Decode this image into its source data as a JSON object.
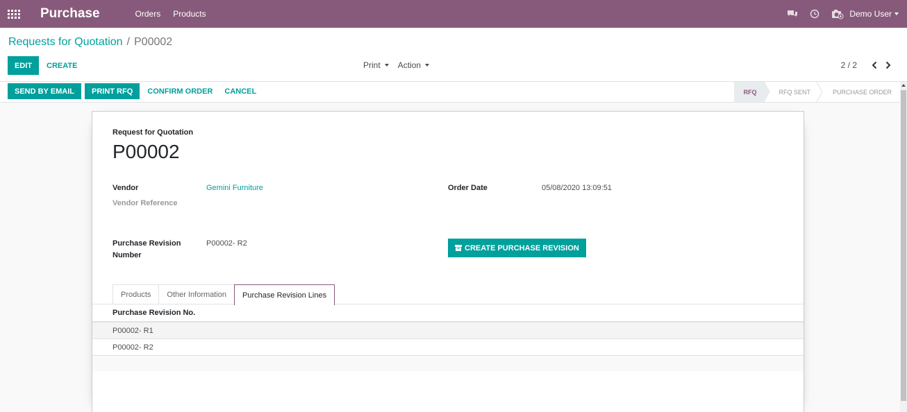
{
  "navbar": {
    "app_name": "Purchase",
    "menu": [
      "Orders",
      "Products"
    ],
    "user": "Demo User"
  },
  "breadcrumb": {
    "parent": "Requests for Quotation",
    "separator": "/",
    "current": "P00002"
  },
  "control": {
    "edit_label": "EDIT",
    "create_label": "CREATE",
    "print_label": "Print",
    "action_label": "Action",
    "pager": "2 / 2"
  },
  "status": {
    "actions": [
      "SEND BY EMAIL",
      "PRINT RFQ",
      "CONFIRM ORDER",
      "CANCEL"
    ],
    "stages": [
      "RFQ",
      "RFQ SENT",
      "PURCHASE ORDER"
    ],
    "active_stage": "RFQ"
  },
  "form": {
    "doc_type": "Request for Quotation",
    "number": "P00002",
    "vendor_label": "Vendor",
    "vendor_value": "Gemini Furniture",
    "vendor_ref_label": "Vendor Reference",
    "order_date_label": "Order Date",
    "order_date_value": "05/08/2020 13:09:51",
    "revision_label_1": "Purchase Revision",
    "revision_label_2": "Number",
    "revision_value": "P00002- R2",
    "revision_button": "CREATE PURCHASE REVISION"
  },
  "tabs": [
    "Products",
    "Other Information",
    "Purchase Revision Lines"
  ],
  "active_tab": "Purchase Revision Lines",
  "table": {
    "header": "Purchase Revision No.",
    "rows": [
      "P00002- R1",
      "P00002- R2"
    ]
  },
  "colors": {
    "brand": "#875a7b",
    "accent": "#00a09d"
  },
  "icons": [
    "apps-grid-icon",
    "chat-icon",
    "clock-icon",
    "camera-icon",
    "chevron-left-icon",
    "chevron-right-icon",
    "archive-icon"
  ]
}
